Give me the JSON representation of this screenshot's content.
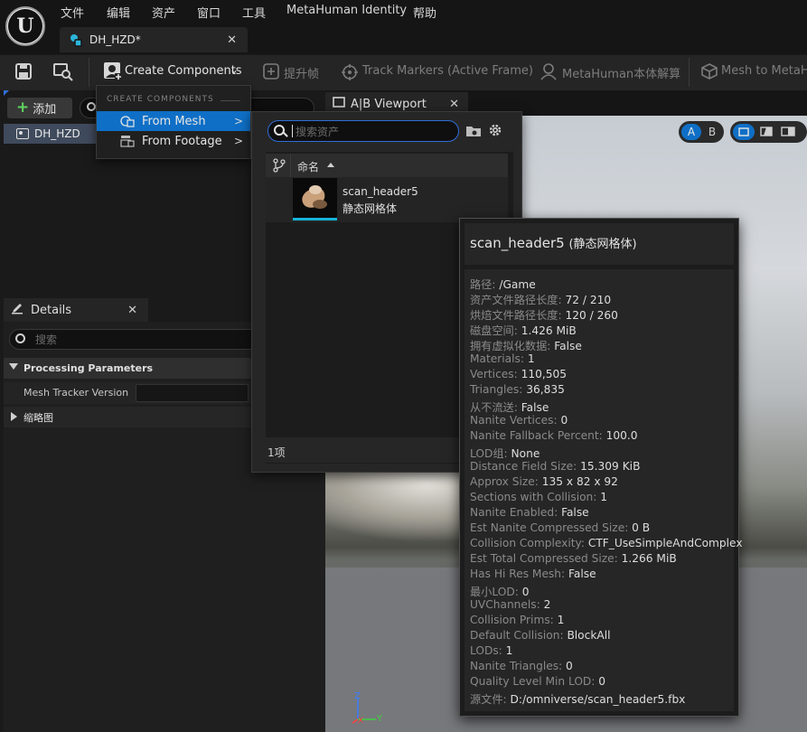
{
  "app": {
    "logo_text": "U",
    "menu": [
      "文件",
      "编辑",
      "资产",
      "窗口",
      "工具",
      "MetaHuman Identity",
      "帮助"
    ],
    "document_tab": "DH_HZD*"
  },
  "toolbar": {
    "create_components": "Create Components",
    "promote_frame": "提升帧",
    "track_markers": "Track Markers (Active Frame)",
    "metahuman_solve": "MetaHuman本体解算",
    "mesh_to_metahuman": "Mesh to MetaHu"
  },
  "outline": {
    "add_button": "添加",
    "items": [
      "DH_HZD"
    ]
  },
  "details": {
    "tab_label": "Details",
    "search_placeholder": "搜索",
    "sections": [
      "Processing Parameters",
      "缩略图"
    ],
    "mesh_tracker_label": "Mesh Tracker Version",
    "mesh_tracker_value": ""
  },
  "viewport": {
    "tab_label": "A|B Viewport",
    "toggle_a": "A",
    "toggle_b": "B",
    "axis_z": "Z",
    "axis_y": "Y",
    "axis_x": "X"
  },
  "create_menu": {
    "header": "CREATE COMPONENTS",
    "items": [
      "From Mesh",
      "From Footage"
    ]
  },
  "asset_picker": {
    "search_placeholder": "搜索资产",
    "column_name": "命名",
    "asset": {
      "name": "scan_header5",
      "type": "静态网格体"
    },
    "count": "1项"
  },
  "tooltip": {
    "title": "scan_header5",
    "subtitle": "(静态网格体)",
    "rows": [
      {
        "key": "路径:",
        "val": "/Game"
      },
      {
        "key": "资产文件路径长度:",
        "val": "72 / 210"
      },
      {
        "key": "烘焙文件路径长度:",
        "val": "120 / 260"
      },
      {
        "key": "磁盘空间:",
        "val": "1.426 MiB"
      },
      {
        "key": "拥有虚拟化数据:",
        "val": "False"
      },
      {
        "key": "Materials:",
        "val": "1"
      },
      {
        "key": "Vertices:",
        "val": "110,505"
      },
      {
        "key": "Triangles:",
        "val": "36,835"
      },
      {
        "key": "从不流送:",
        "val": "False"
      },
      {
        "key": "Nanite Vertices:",
        "val": "0"
      },
      {
        "key": "Nanite Fallback Percent:",
        "val": "100.0"
      },
      {
        "key": "LOD组:",
        "val": "None"
      },
      {
        "key": "Distance Field Size:",
        "val": "15.309 KiB"
      },
      {
        "key": "Approx Size:",
        "val": "135 x 82 x 92"
      },
      {
        "key": "Sections with Collision:",
        "val": "1"
      },
      {
        "key": "Nanite Enabled:",
        "val": "False"
      },
      {
        "key": "Est Nanite Compressed Size:",
        "val": "0 B"
      },
      {
        "key": "Collision Complexity:",
        "val": "CTF_UseSimpleAndComplex"
      },
      {
        "key": "Est Total Compressed Size:",
        "val": "1.266 MiB"
      },
      {
        "key": "Has Hi Res Mesh:",
        "val": "False"
      },
      {
        "key": "最小LOD:",
        "val": "0"
      },
      {
        "key": "UVChannels:",
        "val": "2"
      },
      {
        "key": "Collision Prims:",
        "val": "1"
      },
      {
        "key": "Default Collision:",
        "val": "BlockAll"
      },
      {
        "key": "LODs:",
        "val": "1"
      },
      {
        "key": "Nanite Triangles:",
        "val": "0"
      },
      {
        "key": "Quality Level Min LOD:",
        "val": "0"
      },
      {
        "key": "源文件:",
        "val": "D:/omniverse/scan_header5.fbx"
      }
    ]
  },
  "colors": {
    "accent": "#0f6fc6",
    "thumb_underline": "#16b2d6",
    "add_plus": "#5fd35f"
  }
}
